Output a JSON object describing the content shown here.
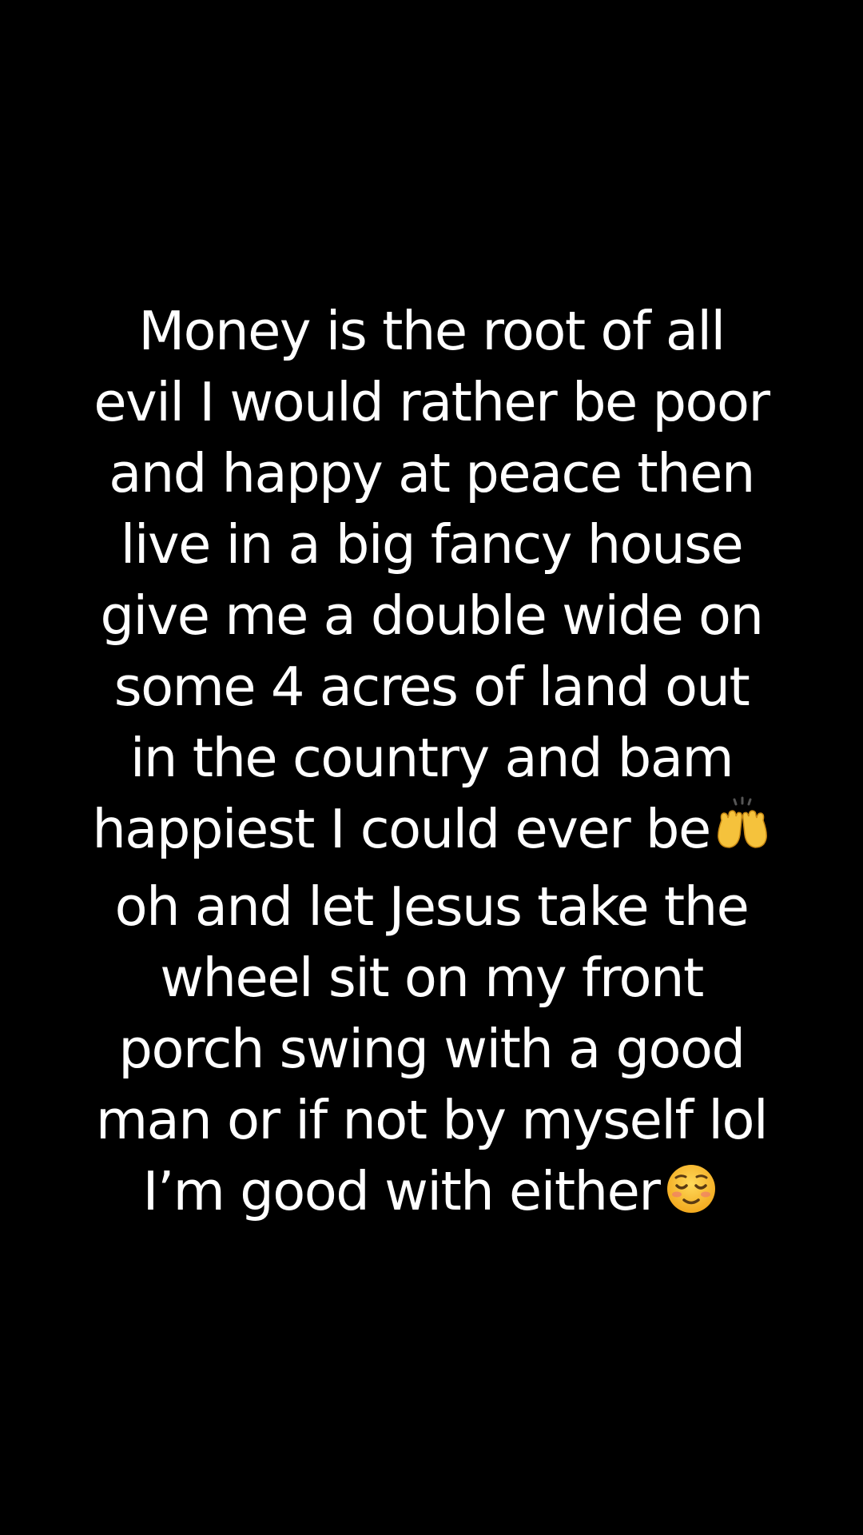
{
  "background_color": "#000000",
  "text_color": "#ffffff",
  "caption": {
    "lines": [
      "Money is the root  of all",
      "evil I would rather be poor",
      "and happy at peace then",
      "live in a big fancy house",
      "give me a double wide on",
      "some 4 acres of land out",
      "in the country and bam",
      "happiest I could ever be",
      "oh and let Jesus take the",
      "wheel sit on my front",
      "porch swing with a good",
      "man or if not by myself lol",
      "I’m good with either"
    ],
    "emoji_line_8": "raising-hands-emoji",
    "emoji_line_13": "smiling-face-emoji"
  }
}
